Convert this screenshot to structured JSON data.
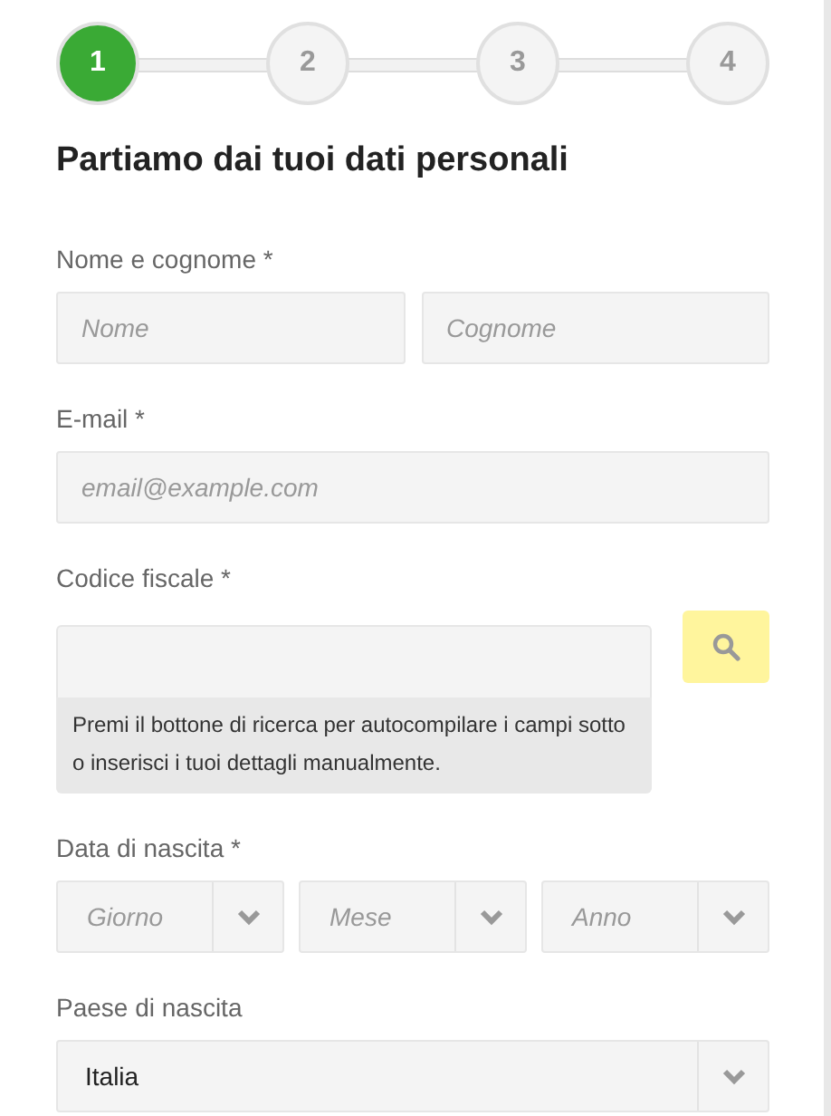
{
  "steps": [
    {
      "label": "1",
      "selected": true
    },
    {
      "label": "2",
      "selected": false
    },
    {
      "label": "3",
      "selected": false
    },
    {
      "label": "4",
      "selected": false
    }
  ],
  "title": "Partiamo dai tuoi dati personali",
  "name": {
    "label": "Nome e cognome *",
    "first_placeholder": "Nome",
    "last_placeholder": "Cognome"
  },
  "email": {
    "label": "E-mail *",
    "placeholder": "email@example.com"
  },
  "tax_code": {
    "label": "Codice fiscale *",
    "hint": "Premi il bottone di ricerca per autocompilare i campi sotto o inserisci i tuoi dettagli manualmente."
  },
  "birth_date": {
    "label": "Data di nascita *",
    "selects": [
      {
        "placeholder": "Giorno"
      },
      {
        "placeholder": "Mese"
      },
      {
        "placeholder": "Anno"
      }
    ]
  },
  "birth_country": {
    "label": "Paese di nascita",
    "value": "Italia"
  }
}
